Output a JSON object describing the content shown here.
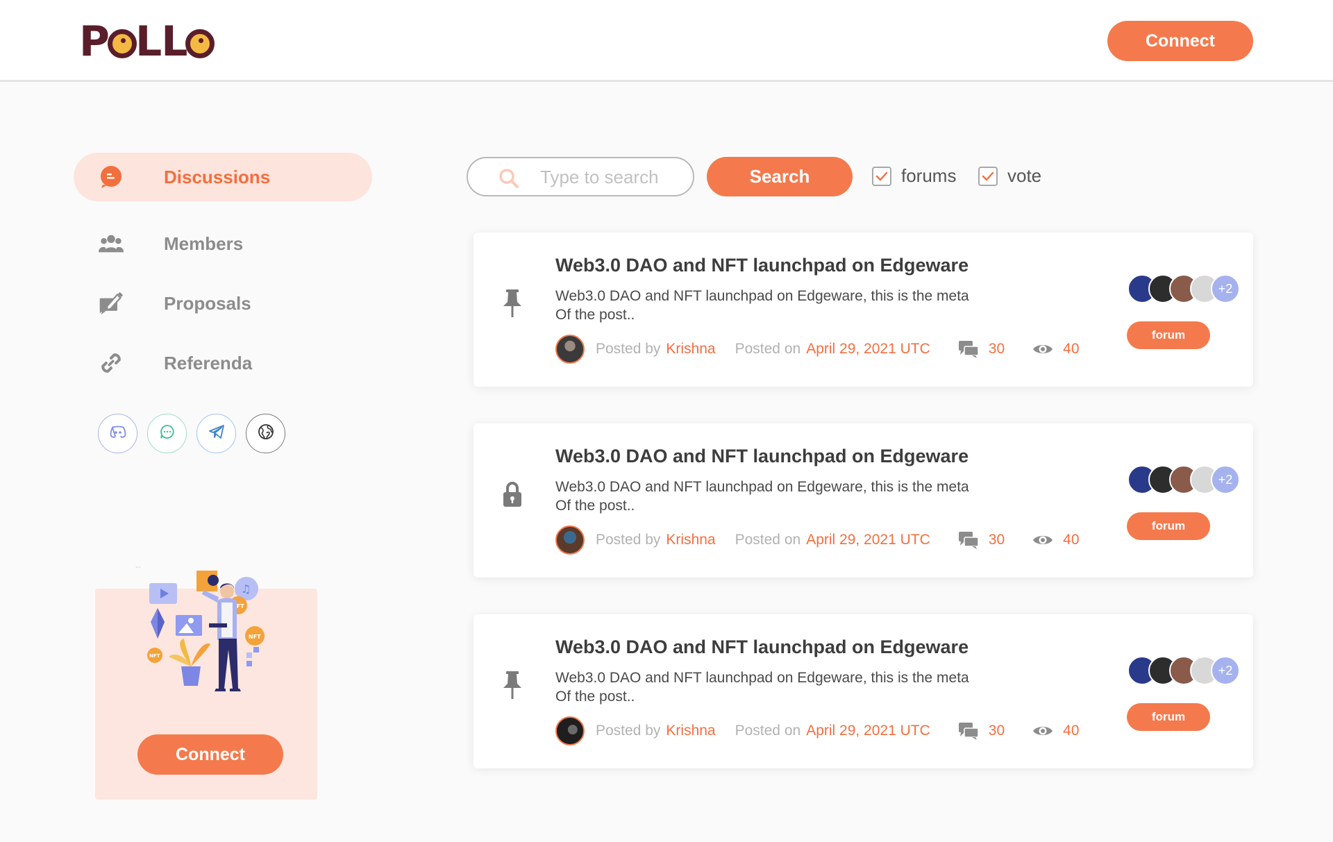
{
  "header": {
    "logo_text": "PoLLo",
    "connect_label": "Connect"
  },
  "sidebar": {
    "items": [
      {
        "label": "Discussions",
        "icon": "chat-bubble-icon",
        "active": true
      },
      {
        "label": "Members",
        "icon": "users-icon",
        "active": false
      },
      {
        "label": "Proposals",
        "icon": "edit-note-icon",
        "active": false
      },
      {
        "label": "Referenda",
        "icon": "link-icon",
        "active": false
      }
    ],
    "socials": [
      "discord-icon",
      "element-chat-icon",
      "telegram-icon",
      "web-globe-icon"
    ],
    "promo": {
      "connect_label": "Connect"
    }
  },
  "search": {
    "placeholder": "Type to search",
    "button_label": "Search",
    "filters": [
      {
        "label": "forums",
        "checked": true
      },
      {
        "label": "vote",
        "checked": true
      }
    ]
  },
  "posts": [
    {
      "icon": "pin-icon",
      "title": "Web3.0 DAO and NFT launchpad on Edgeware",
      "desc_line1": "Web3.0 DAO and NFT launchpad on Edgeware, this is the meta",
      "desc_line2": "Of the post..",
      "posted_by_label": "Posted by",
      "author": "Krishna",
      "posted_on_label": "Posted on",
      "date": "April 29, 2021 UTC",
      "comments": "30",
      "views": "40",
      "participants_more": "+2",
      "tag": "forum"
    },
    {
      "icon": "lock-icon",
      "title": "Web3.0 DAO and NFT launchpad on Edgeware",
      "desc_line1": "Web3.0 DAO and NFT launchpad on Edgeware, this is the meta",
      "desc_line2": "Of the post..",
      "posted_by_label": "Posted by",
      "author": "Krishna",
      "posted_on_label": "Posted on",
      "date": "April 29, 2021 UTC",
      "comments": "30",
      "views": "40",
      "participants_more": "+2",
      "tag": "forum"
    },
    {
      "icon": "pin-icon",
      "title": "Web3.0 DAO and NFT launchpad on Edgeware",
      "desc_line1": "Web3.0 DAO and NFT launchpad on Edgeware, this is the meta",
      "desc_line2": "Of the post..",
      "posted_by_label": "Posted by",
      "author": "Krishna",
      "posted_on_label": "Posted on",
      "date": "April 29, 2021 UTC",
      "comments": "30",
      "views": "40",
      "participants_more": "+2",
      "tag": "forum"
    }
  ],
  "colors": {
    "accent": "#f47a4d",
    "accent_text": "#f26f3e",
    "active_bg": "#fde4dc",
    "logo": "#5a1e2a",
    "chick": "#f4b942",
    "more_badge": "#a5b2ee"
  }
}
